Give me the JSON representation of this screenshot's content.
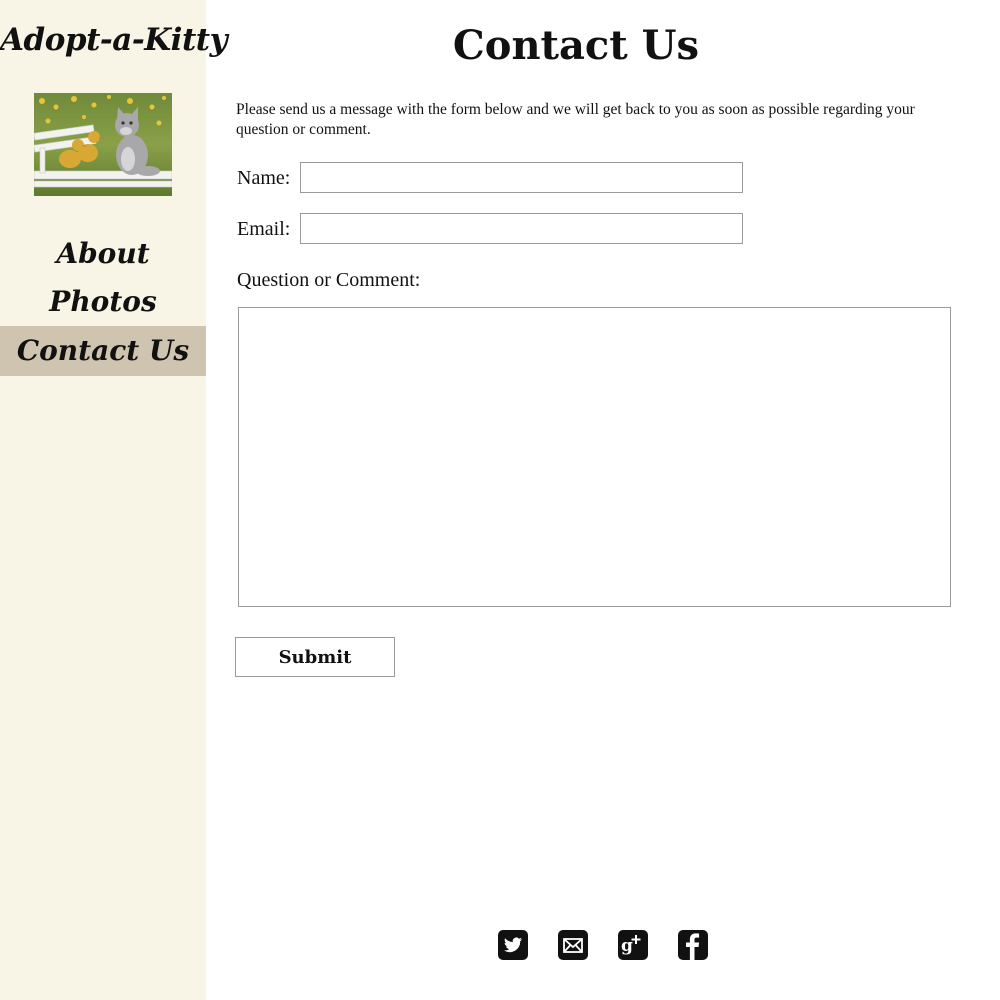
{
  "site": {
    "title": "Adopt-a-Kitty",
    "hero_photo_alt": "kitten with ducklings"
  },
  "nav": {
    "items": [
      {
        "label": "About",
        "active": false
      },
      {
        "label": "Photos",
        "active": false
      },
      {
        "label": "Contact Us",
        "active": true
      }
    ]
  },
  "main": {
    "title": "Contact Us",
    "intro": "Please send us a message with the form below and we will get back to you as soon as possible regarding your question or comment.",
    "form": {
      "name_label": "Name:",
      "name_value": "",
      "email_label": "Email:",
      "email_value": "",
      "comment_label": "Question or Comment:",
      "comment_value": "",
      "submit_label": "Submit"
    }
  },
  "social": {
    "icons": [
      "twitter-icon",
      "mail-icon",
      "google-plus-icon",
      "facebook-icon"
    ]
  },
  "colors": {
    "sidebar_bg": "#f8f4e6",
    "nav_active_bg": "#cfc4b0",
    "text": "#111111",
    "border": "#9a9a9a"
  }
}
